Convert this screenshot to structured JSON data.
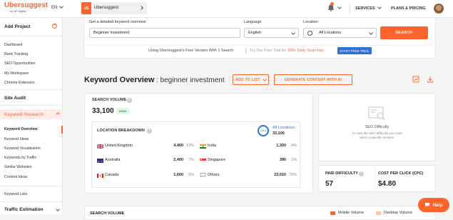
{
  "header": {
    "logo": "Ubersuggest",
    "logo_sub": "by NP digital",
    "language": "EN",
    "project_badge": "US",
    "project_name": "Ubersuggest",
    "nav_services": "SERVICES",
    "nav_plans": "PLANS & PRICING"
  },
  "sidebar": {
    "add_project": "Add Project",
    "group1": [
      "Dashboard",
      "Rank Tracking",
      "SEO Opportunities",
      "My Workspace",
      "Chrome Extension"
    ],
    "site_audit": "Site Audit",
    "keyword_research": "Keyword Research",
    "kr_items": [
      "Keyword Overview",
      "Keyword Ideas",
      "Keyword Visualization",
      "Keywords by Traffic",
      "Similar Websites",
      "Content Ideas"
    ],
    "keyword_lists": "Keyword Lists",
    "traffic_estimation": "Traffic Estimation"
  },
  "search": {
    "keyword_label": "Get a detailed keyword overview",
    "keyword_value": "Beginner investment",
    "language_label": "Language",
    "language_value": "English",
    "location_label": "Location",
    "location_value": "All Locations",
    "button": "SEARCH",
    "free_text": "Using Ubersuggest's Free Version With 1 Search",
    "trial_text_pre": "Try Our Free Trial for ",
    "trial_text_hl": "150+ Daily Searches",
    "trial_button": "START FREE TRIAL"
  },
  "overview": {
    "title": "Keyword Overview",
    "keyword": ": beginner investment",
    "add_to_list": "ADD TO LIST",
    "generate_ai": "GENERATE CONTENT WITH AI"
  },
  "volume": {
    "label": "SEARCH VOLUME",
    "value": "33,100",
    "badge": "HIGH",
    "breakdown_label": "LOCATION BREAKDOWN",
    "all_locations": "All Locations",
    "all_value": "33,100",
    "donut_pct": "100%",
    "countries": [
      {
        "name": "United Kingdom",
        "value": "4,400",
        "pct": "13%"
      },
      {
        "name": "India",
        "value": "1,300",
        "pct": "4%"
      },
      {
        "name": "Australia",
        "value": "2,400",
        "pct": "7%"
      },
      {
        "name": "Singapore",
        "value": "390",
        "pct": "1%"
      },
      {
        "name": "Canada",
        "value": "1,600",
        "pct": "5%"
      },
      {
        "name": "Others",
        "value": "23,010",
        "pct": "70%"
      }
    ]
  },
  "seo_difficulty": {
    "title": "SEO Difficulty",
    "desc_1": "To view the SEO difficulty you must",
    "desc_2": "select a specific location."
  },
  "metrics": {
    "paid_difficulty_label": "PAID DIFFICULTY",
    "paid_difficulty_value": "57",
    "cpc_label": "COST PER CLICK (CPC)",
    "cpc_value": "$4.80"
  },
  "bottom": {
    "label": "SEARCH VOLUME",
    "legend1": "Mobile Volume",
    "legend2": "Desktop Volume"
  },
  "help": "Help",
  "colors": {
    "accent": "#ff642d",
    "blue": "#2e6fd8",
    "green": "#2e9a4a"
  }
}
